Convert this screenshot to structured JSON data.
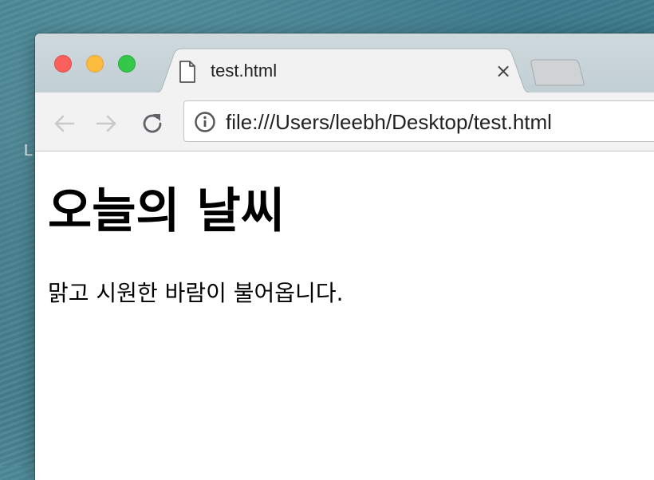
{
  "desktop": {
    "label": "L"
  },
  "browser": {
    "tab": {
      "title": "test.html",
      "close_glyph": "×",
      "icon": "file-icon"
    },
    "toolbar": {
      "url": "file:///Users/leebh/Desktop/test.html",
      "site_info_icon": "info-icon",
      "back_icon": "arrow-left-icon",
      "forward_icon": "arrow-right-icon",
      "reload_icon": "reload-icon"
    },
    "window_controls": {
      "close_color": "#fc605c",
      "minimize_color": "#fdbc40",
      "zoom_color": "#34c84a"
    }
  },
  "page": {
    "heading": "오늘의 날씨",
    "paragraph": "맑고 시원한 바람이 불어옵니다."
  }
}
